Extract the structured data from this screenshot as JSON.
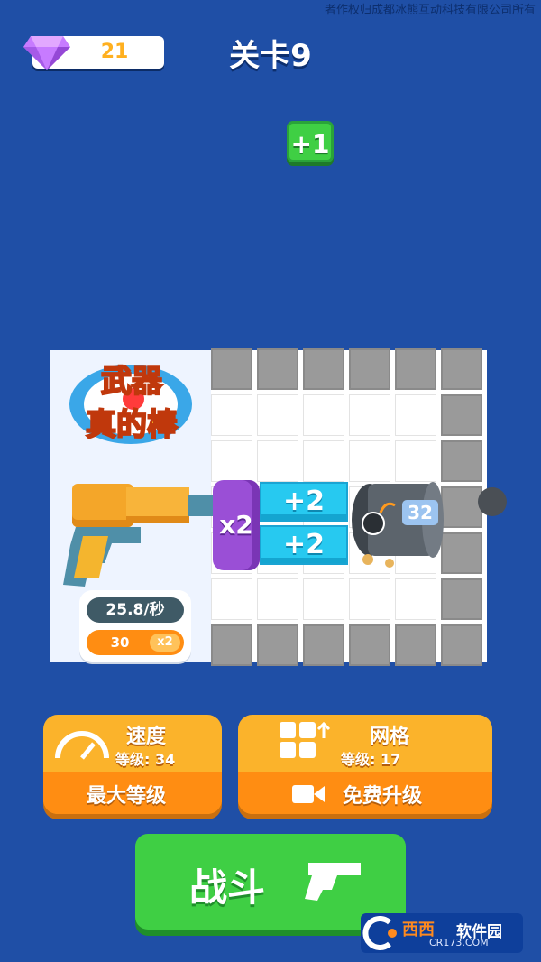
{
  "copyright_text": "者作权归成都冰熊互动科技有限公司所有",
  "header": {
    "gems": "21",
    "level_title": "关卡9"
  },
  "reward_badge": "+1",
  "logo_text": [
    "武器",
    "真的棒"
  ],
  "board": {
    "multiplier_drum": "x2",
    "plus_blocks": [
      "+2",
      "+2"
    ],
    "cannon_count": "32"
  },
  "stats": {
    "rate": "25.8/秒",
    "damage": "30",
    "damage_multiplier": "x2"
  },
  "upgrades": [
    {
      "title": "速度",
      "level": "等级: 34",
      "action": "最大等级"
    },
    {
      "title": "网格",
      "level": "等级: 17",
      "action": "免费升级"
    }
  ],
  "fight_button": "战斗",
  "watermark": {
    "brand": "西西",
    "suffix": "软件园",
    "url": "CR173.COM"
  },
  "colors": {
    "background": "#1f4fa6",
    "accent_green": "#3fcf44",
    "upgrade_orange": "#ff8d12",
    "plus_block": "#27c9f0",
    "drum_purple": "#9a4fd6"
  }
}
